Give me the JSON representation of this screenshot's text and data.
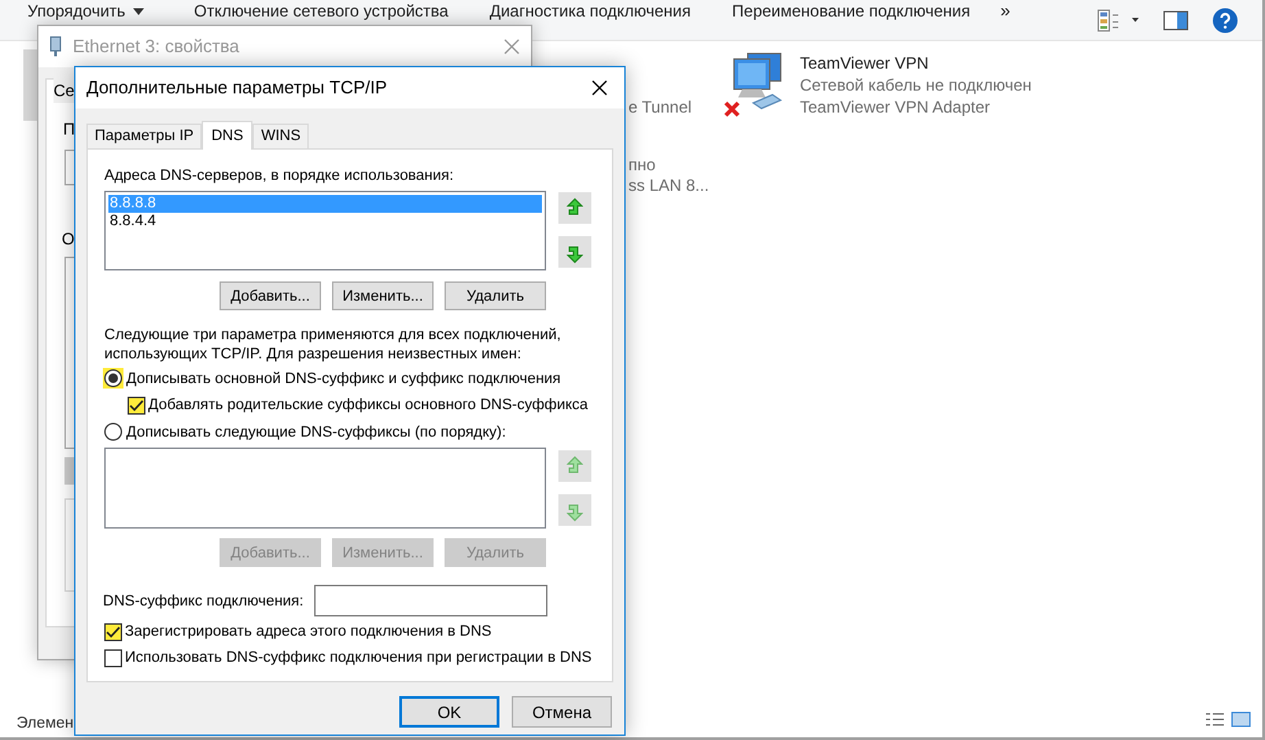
{
  "explorer": {
    "toolbar": {
      "items": [
        "Упорядочить",
        "Отключение сетевого устройства",
        "Диагностика подключения",
        "Переименование подключения"
      ],
      "more": "»"
    },
    "fragments": [
      "e Tunnel",
      "пно",
      "ss LAN 8..."
    ],
    "connection": {
      "name": "TeamViewer VPN",
      "status": "Сетевой кабель не подключен",
      "adapter": "TeamViewer VPN Adapter",
      "disconnected": true
    },
    "status_bar": "Элемен"
  },
  "properties_window": {
    "title": "Ethernet 3: свойства",
    "fragments": [
      "Се",
      "П",
      "О"
    ]
  },
  "dialog": {
    "title": "Дополнительные параметры TCP/IP",
    "tabs": [
      {
        "label": "Параметры IP",
        "selected": false
      },
      {
        "label": "DNS",
        "selected": true
      },
      {
        "label": "WINS",
        "selected": false
      }
    ],
    "dns_servers": {
      "label": "Адреса DNS-серверов, в порядке использования:",
      "items": [
        {
          "text": "8.8.8.8",
          "selected": true
        },
        {
          "text": "8.8.4.4",
          "selected": false
        }
      ]
    },
    "server_buttons": [
      {
        "label": "Добавить...",
        "disabled": false
      },
      {
        "label": "Изменить...",
        "disabled": false
      },
      {
        "label": "Удалить",
        "disabled": false
      }
    ],
    "description": "Следующие три параметра применяются для всех подключений, использующих TCP/IP. Для разрешения неизвестных имен:",
    "options": [
      {
        "kind": "radio",
        "label": "Дописывать основной DNS-суффикс и суффикс подключения",
        "selected": true
      },
      {
        "kind": "checkbox",
        "label": "Добавлять родительские суффиксы основного DNS-суффикса",
        "checked": true
      },
      {
        "kind": "radio",
        "label": "Дописывать следующие DNS-суффиксы (по порядку):",
        "selected": false
      }
    ],
    "suffix_buttons": [
      {
        "label": "Добавить...",
        "disabled": true
      },
      {
        "label": "Изменить...",
        "disabled": true
      },
      {
        "label": "Удалить",
        "disabled": true
      }
    ],
    "suffix_field": {
      "label": "DNS-суффикс подключения:"
    },
    "register_options": [
      {
        "label": "Зарегистрировать адреса этого подключения в DNS",
        "checked": true
      },
      {
        "label": "Использовать DNS-суффикс подключения при регистрации в DNS",
        "checked": false
      }
    ],
    "buttons": [
      {
        "label": "OK",
        "default": true
      },
      {
        "label": "Отмена",
        "default": false
      }
    ]
  }
}
